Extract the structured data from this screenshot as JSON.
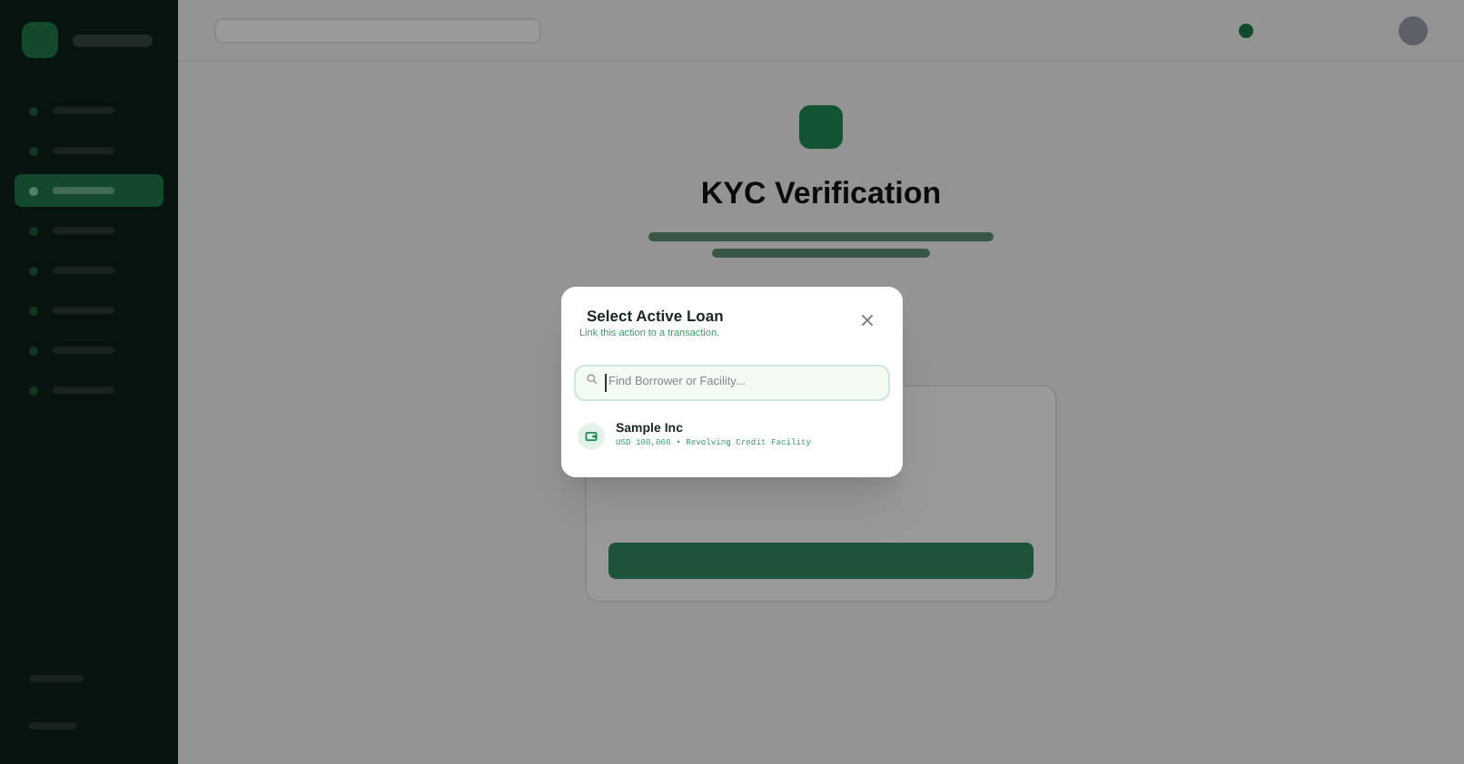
{
  "sidebar": {
    "items": [
      {
        "selected": false
      },
      {
        "selected": false
      },
      {
        "selected": true
      },
      {
        "selected": false
      },
      {
        "selected": false
      },
      {
        "selected": false
      },
      {
        "selected": false
      },
      {
        "selected": false
      }
    ]
  },
  "page": {
    "title": "KYC Verification"
  },
  "dialog": {
    "title": "Select Active Loan",
    "subtitle": "Link this action to a transaction.",
    "search": {
      "placeholder": "Find Borrower or Facility..."
    },
    "loans": [
      {
        "name": "Sample Inc",
        "detail": "USD 100,000 • Revolving Credit Facility"
      }
    ]
  }
}
